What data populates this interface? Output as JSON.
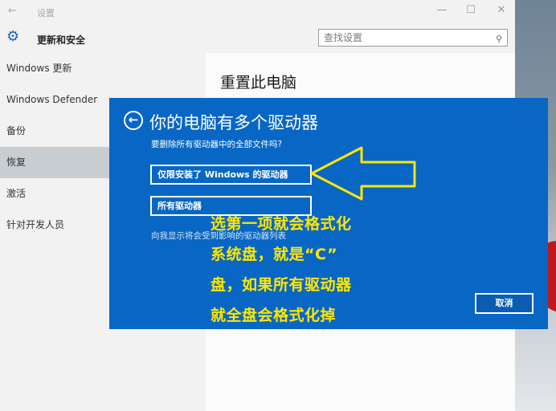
{
  "window": {
    "title": "设置",
    "controls": {
      "minimize": "—",
      "maximize": "☐",
      "close": "✕"
    },
    "back": "←"
  },
  "header": {
    "section_title": "更新和安全",
    "search_placeholder": "查找设置",
    "gear_glyph": "⚙",
    "search_glyph": "⚲"
  },
  "sidebar": {
    "items": [
      {
        "label": "Windows 更新"
      },
      {
        "label": "Windows Defender"
      },
      {
        "label": "备份"
      },
      {
        "label": "恢复",
        "active": true
      },
      {
        "label": "激活"
      },
      {
        "label": "针对开发人员"
      }
    ]
  },
  "content": {
    "title": "重置此电脑"
  },
  "dialog": {
    "back_glyph": "←",
    "title": "你的电脑有多个驱动器",
    "subtitle": "要删除所有驱动器中的全部文件吗?",
    "option1": "仅限安装了 Windows 的驱动器",
    "option2": "所有驱动器",
    "link": "向我显示将会受到影响的驱动器列表",
    "cancel": "取消"
  },
  "annotation": {
    "lines": [
      "选第一项就会格式化",
      "系统盘，就是“C”",
      "盘，如果所有驱动器",
      "就全盘会格式化掉"
    ],
    "color": "#ffe600"
  }
}
